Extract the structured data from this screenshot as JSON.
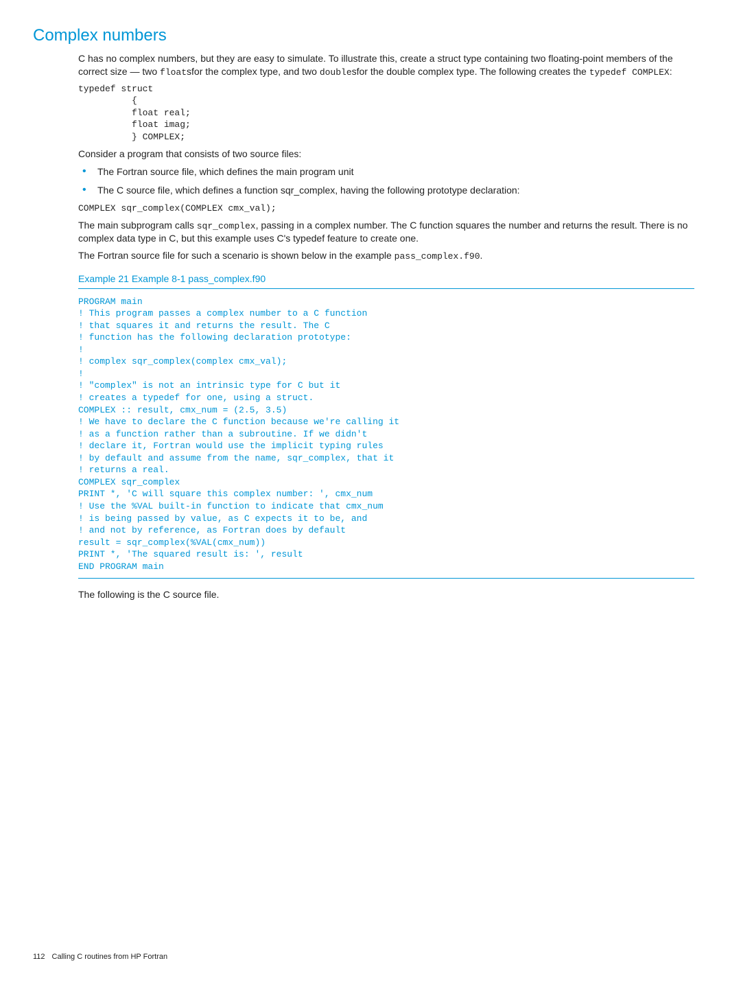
{
  "heading": "Complex numbers",
  "para1_pre": "C has no complex numbers, but they are easy to simulate. To illustrate this, create a struct type containing two floating-point members of the correct size — two ",
  "para1_code1": "float",
  "para1_mid1": "sfor the complex type, and two ",
  "para1_code2": "double",
  "para1_mid2": "sfor the double complex type. The following creates the ",
  "para1_code3": "typedef COMPLEX",
  "para1_end": ":",
  "code_typedef": "typedef struct\n          {\n          float real;\n          float imag;\n          } COMPLEX;",
  "para2": "Consider a program that consists of two source files:",
  "bullet1": "The Fortran source file, which defines the main program unit",
  "bullet2": "The C source file, which defines a function sqr_complex, having the following prototype declaration:",
  "code_proto": "COMPLEX sqr_complex(COMPLEX cmx_val);",
  "para3_pre": "The main subprogram calls ",
  "para3_code1": "sqr_complex",
  "para3_post": ", passing in a complex number. The C function squares the number and returns the result. There is no complex data type in C, but this example uses C's typedef feature to create one.",
  "para4_pre": "The Fortran source file for such a scenario is shown below in the example ",
  "para4_code1": "pass_complex.f90",
  "para4_post": ".",
  "example_title": "Example 21 Example 8-1 pass_complex.f90",
  "example_code": "PROGRAM main\n! This program passes a complex number to a C function\n! that squares it and returns the result. The C\n! function has the following declaration prototype:\n!\n! complex sqr_complex(complex cmx_val);\n!\n! \"complex\" is not an intrinsic type for C but it\n! creates a typedef for one, using a struct.\nCOMPLEX :: result, cmx_num = (2.5, 3.5)\n! We have to declare the C function because we're calling it\n! as a function rather than a subroutine. If we didn't\n! declare it, Fortran would use the implicit typing rules\n! by default and assume from the name, sqr_complex, that it\n! returns a real.\nCOMPLEX sqr_complex\nPRINT *, 'C will square this complex number: ', cmx_num\n! Use the %VAL built-in function to indicate that cmx_num\n! is being passed by value, as C expects it to be, and\n! and not by reference, as Fortran does by default\nresult = sqr_complex(%VAL(cmx_num))\nPRINT *, 'The squared result is: ', result\nEND PROGRAM main",
  "para5": "The following is the C source file.",
  "footer_page": "112",
  "footer_text": "Calling C routines from HP Fortran"
}
